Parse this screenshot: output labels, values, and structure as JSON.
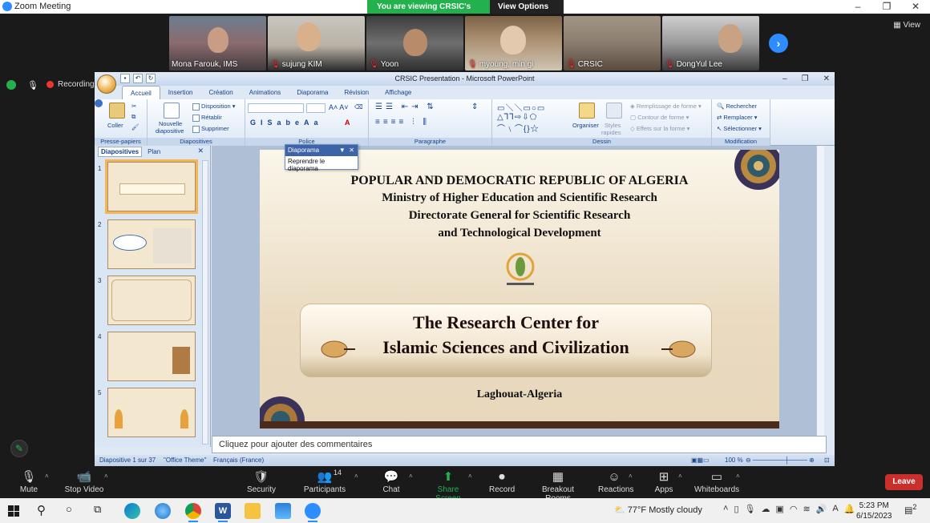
{
  "zoom": {
    "window_title": "Zoom Meeting",
    "banner_message": "You are viewing CRSIC's screen",
    "view_options": "View Options",
    "view_button": "View",
    "recording_label": "Recording",
    "participants": [
      {
        "name": "Mona Farouk, IMS",
        "muted": false
      },
      {
        "name": "sujung KIM",
        "muted": true
      },
      {
        "name": "Yoon",
        "muted": true
      },
      {
        "name": "myoung, min gi",
        "muted": true
      },
      {
        "name": "CRSIC",
        "muted": true
      },
      {
        "name": "DongYul Lee",
        "muted": true
      }
    ],
    "controls": {
      "mute": "Mute",
      "stop_video": "Stop Video",
      "security": "Security",
      "participants": "Participants",
      "participants_count": "14",
      "chat": "Chat",
      "share_screen": "Share Screen",
      "record": "Record",
      "breakout_rooms": "Breakout Rooms",
      "reactions": "Reactions",
      "apps": "Apps",
      "whiteboards": "Whiteboards",
      "leave": "Leave"
    }
  },
  "powerpoint": {
    "window_title": "CRSIC Presentation - Microsoft PowerPoint",
    "tabs": [
      "Accueil",
      "Insertion",
      "Création",
      "Animations",
      "Diaporama",
      "Révision",
      "Affichage"
    ],
    "active_tab": "Accueil",
    "ribbon": {
      "presse_papiers": {
        "label": "Presse-papiers",
        "coller": "Coller"
      },
      "diapositives": {
        "label": "Diapositives",
        "nouvelle": "Nouvelle",
        "diapositive": "diapositive",
        "disposition": "Disposition",
        "retablir": "Rétablir",
        "supprimer": "Supprimer"
      },
      "police": {
        "label": "Police"
      },
      "paragraphe": {
        "label": "Paragraphe"
      },
      "dessin": {
        "label": "Dessin",
        "organiser": "Organiser",
        "styles": "Styles",
        "rapides": "rapides",
        "remplissage": "Remplissage de forme",
        "contour": "Contour de forme",
        "effets": "Effets sur la forme"
      },
      "modification": {
        "label": "Modification",
        "rechercher": "Rechercher",
        "remplacer": "Remplacer",
        "selectionner": "Sélectionner"
      }
    },
    "popup": {
      "title": "Diaporama",
      "action": "Reprendre le diaporama"
    },
    "panel_tabs": {
      "diapositives": "Diapositives",
      "plan": "Plan"
    },
    "slide_numbers": [
      "1",
      "2",
      "3",
      "4",
      "5"
    ],
    "slide": {
      "line1": "POPULAR AND DEMOCRATIC REPUBLIC OF ALGERIA",
      "line2": "Ministry of Higher Education and Scientific Research",
      "line3": "Directorate General for Scientific Research",
      "line4": "and Technological Development",
      "center_title_1": "The Research Center for",
      "center_title_2": "Islamic Sciences and Civilization",
      "location": "Laghouat-Algeria"
    },
    "notes_placeholder": "Cliquez pour ajouter des commentaires",
    "status": {
      "slide_count": "Diapositive 1 sur 37",
      "theme": "\"Office Theme\"",
      "language": "Français (France)",
      "zoom": "100 %"
    }
  },
  "taskbar": {
    "temperature": "77°F",
    "weather": "Mostly cloudy",
    "time": "5:23 PM",
    "date": "6/15/2023",
    "notification_count": "2"
  }
}
